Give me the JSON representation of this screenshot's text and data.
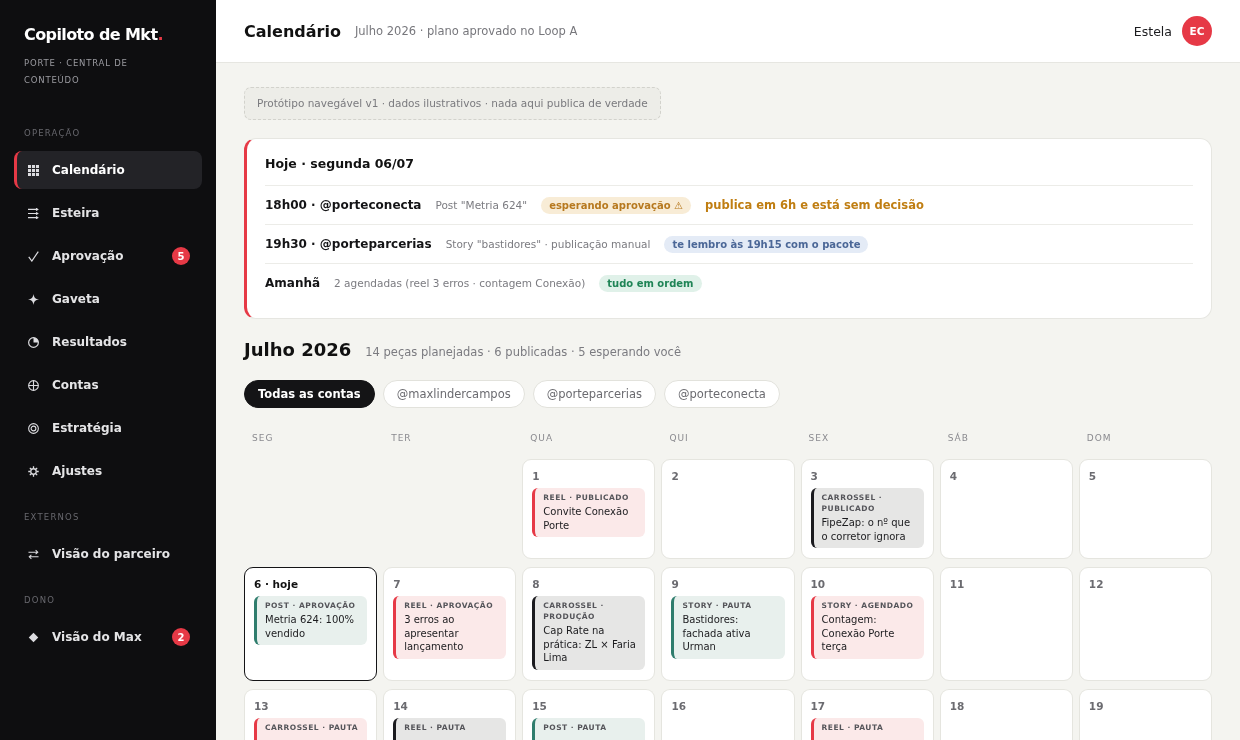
{
  "sidebar": {
    "brand": {
      "name": "Copiloto de Mkt",
      "accent": "."
    },
    "tagline": "PORTE · CENTRAL DE CONTEÚDO",
    "sections": [
      {
        "title": "OPERAÇÃO",
        "items": [
          {
            "label": "Calendário",
            "selected": true
          },
          {
            "label": "Esteira",
            "selected": false
          },
          {
            "label": "Aprovação",
            "selected": false,
            "badge": "5"
          },
          {
            "label": "Gaveta",
            "selected": false
          },
          {
            "label": "Resultados",
            "selected": false
          },
          {
            "label": "Contas",
            "selected": false
          },
          {
            "label": "Estratégia",
            "selected": false
          },
          {
            "label": "Ajustes",
            "selected": false
          }
        ]
      },
      {
        "title": "EXTERNOS",
        "items": [
          {
            "label": "Visão do parceiro",
            "selected": false
          }
        ]
      },
      {
        "title": "DONO",
        "items": [
          {
            "label": "Visão do Max",
            "selected": false,
            "badge": "2"
          }
        ]
      }
    ]
  },
  "header": {
    "title": "Calendário",
    "subtitle": "Julho 2026 · plano aprovado no Loop A",
    "user": {
      "name": "Estela",
      "initials": "EC"
    }
  },
  "notice": "Protótipo navegável v1 · dados ilustrativos · nada aqui publica de verdade",
  "today": {
    "title": "Hoje · segunda 06/07",
    "rows": [
      {
        "heading": "18h00 · @porteconecta",
        "detail": "Post \"Metria 624\"",
        "status": {
          "text": "esperando aprovação ⚠",
          "kind": "warning"
        },
        "note": "publica em 6h e está sem decisão"
      },
      {
        "heading": "19h30 · @porteparcerias",
        "detail": "Story \"bastidores\" · publicação manual",
        "status": {
          "text": "te lembro às 19h15 com o pacote",
          "kind": "info"
        }
      },
      {
        "heading": "Amanhã",
        "detail": "2 agendadas (reel 3 erros · contagem Conexão)",
        "status": {
          "text": "tudo em ordem",
          "kind": "ok"
        }
      }
    ]
  },
  "month": {
    "title": "Julho 2026",
    "summary": "14 peças planejadas · 6 publicadas · 5 esperando você",
    "filters": [
      {
        "label": "Todas as contas",
        "selected": true
      },
      {
        "label": "@maxlindercampos",
        "selected": false
      },
      {
        "label": "@porteparcerias",
        "selected": false
      },
      {
        "label": "@porteconecta",
        "selected": false
      }
    ],
    "weekdays": [
      "SEG",
      "TER",
      "QUA",
      "QUI",
      "SEX",
      "SÁB",
      "DOM"
    ],
    "weeks": [
      {
        "days": [
          {
            "kind": "blank"
          },
          {
            "kind": "blank"
          },
          {
            "kind": "day",
            "number": "1",
            "today": false,
            "entries": [
              {
                "label": "REEL · PUBLICADO",
                "title": "Convite Conexão Porte",
                "color": "#e63946"
              }
            ]
          },
          {
            "kind": "day",
            "number": "2",
            "today": false
          },
          {
            "kind": "day",
            "number": "3",
            "today": false,
            "entries": [
              {
                "label": "CARROSSEL · PUBLICADO",
                "title": "FipeZap: o nº que o corretor ignora",
                "color": "#1b1b1f"
              }
            ]
          },
          {
            "kind": "day",
            "number": "4",
            "today": false
          },
          {
            "kind": "day",
            "number": "5",
            "today": false
          }
        ]
      },
      {
        "days": [
          {
            "kind": "day",
            "number": "6 · hoje",
            "today": true,
            "entries": [
              {
                "label": "POST · APROVAÇÃO",
                "title": "Metria 624: 100% vendido",
                "color": "#2f7d6d"
              }
            ]
          },
          {
            "kind": "day",
            "number": "7",
            "today": false,
            "entries": [
              {
                "label": "REEL · APROVAÇÃO",
                "title": "3 erros ao apresentar lançamento",
                "color": "#e63946"
              }
            ]
          },
          {
            "kind": "day",
            "number": "8",
            "today": false,
            "entries": [
              {
                "label": "CARROSSEL · PRODUÇÃO",
                "title": "Cap Rate na prática: ZL × Faria Lima",
                "color": "#1b1b1f"
              }
            ]
          },
          {
            "kind": "day",
            "number": "9",
            "today": false,
            "entries": [
              {
                "label": "STORY · PAUTA",
                "title": "Bastidores: fachada ativa Urman",
                "color": "#2f7d6d"
              }
            ]
          },
          {
            "kind": "day",
            "number": "10",
            "today": false,
            "entries": [
              {
                "label": "STORY · AGENDADO",
                "title": "Contagem: Conexão Porte terça",
                "color": "#e63946"
              }
            ]
          },
          {
            "kind": "day",
            "number": "11",
            "today": false
          },
          {
            "kind": "day",
            "number": "12",
            "today": false
          }
        ]
      },
      {
        "days": [
          {
            "kind": "day",
            "number": "13",
            "today": false,
            "entries": [
              {
                "label": "CARROSSEL · PAUTA",
                "color": "#e63946"
              }
            ]
          },
          {
            "kind": "day",
            "number": "14",
            "today": false,
            "entries": [
              {
                "label": "REEL · PAUTA",
                "color": "#1b1b1f"
              }
            ]
          },
          {
            "kind": "day",
            "number": "15",
            "today": false,
            "entries": [
              {
                "label": "POST · PAUTA",
                "color": "#2f7d6d"
              }
            ]
          },
          {
            "kind": "day",
            "number": "16",
            "today": false
          },
          {
            "kind": "day",
            "number": "17",
            "today": false,
            "entries": [
              {
                "label": "REEL · PAUTA",
                "color": "#e63946"
              }
            ]
          },
          {
            "kind": "day",
            "number": "18",
            "today": false
          },
          {
            "kind": "day",
            "number": "19",
            "today": false
          }
        ]
      }
    ]
  }
}
